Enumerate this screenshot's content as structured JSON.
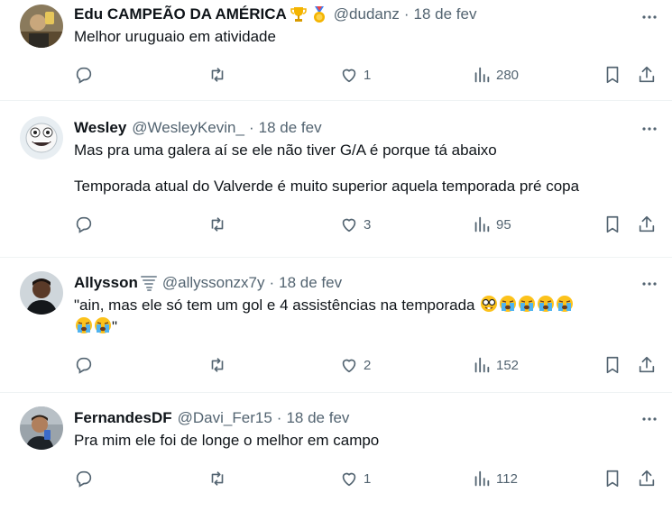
{
  "tweets": [
    {
      "name": "Edu CAMPEÃO DA AMÉRICA",
      "handle": "@dudanz",
      "date": "18 de fev",
      "lines": [
        "Melhor uruguaio em atividade"
      ],
      "replies": "",
      "retweets": "",
      "likes": "1",
      "views": "280",
      "emojis": [
        "trophy-icon",
        "medal-icon"
      ]
    },
    {
      "name": "Wesley",
      "handle": "@WesleyKevin_",
      "date": "18 de fev",
      "lines": [
        "Mas pra uma galera aí se ele não tiver G/A é porque tá abaixo",
        "Temporada atual do Valverde é muito superior aquela temporada pré copa"
      ],
      "replies": "",
      "retweets": "",
      "likes": "3",
      "views": "95"
    },
    {
      "name": "Allysson",
      "handle": "@allyssonzx7y",
      "date": "18 de fev",
      "lines": [
        "\"ain, mas ele só tem um gol e 4 assistências na temporada",
        "\""
      ],
      "replies": "",
      "retweets": "",
      "likes": "2",
      "views": "152",
      "emojis": [
        "tornado-icon",
        "nerd-face-icon",
        "crying-face-icon"
      ]
    },
    {
      "name": "FernandesDF",
      "handle": "@Davi_Fer15",
      "date": "18 de fev",
      "lines": [
        "Pra mim ele foi de longe o melhor em campo"
      ],
      "replies": "",
      "retweets": "",
      "likes": "1",
      "views": "112"
    }
  ],
  "separator": "·",
  "colors": {
    "text": "#0f1419",
    "secondary": "#536471",
    "border": "#eff3f4"
  }
}
